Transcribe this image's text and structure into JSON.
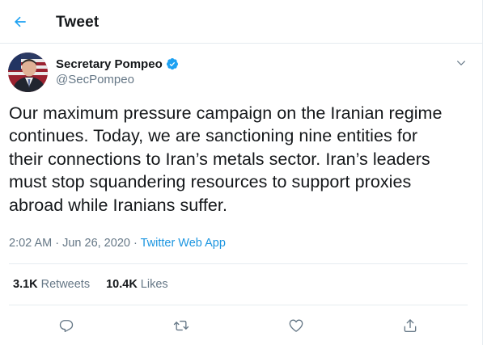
{
  "header": {
    "title": "Tweet",
    "back_icon": "arrow-left-icon",
    "accent": "#1da1f2"
  },
  "author": {
    "display_name": "Secretary Pompeo",
    "handle": "@SecPompeo",
    "verified": true,
    "verified_icon": "verified-badge-icon",
    "more_icon": "chevron-down-icon"
  },
  "tweet": {
    "text_lines": [
      "Our maximum pressure campaign on the Iranian regime",
      "continues. Today, we are sanctioning nine entities for",
      "their connections to Iran’s metals sector. Iran’s leaders",
      "must stop squandering resources to support proxies",
      "abroad while Iranians suffer."
    ],
    "time": "2:02 AM",
    "separator1": " · ",
    "date": "Jun 26, 2020",
    "separator2": " · ",
    "source": "Twitter Web App"
  },
  "stats": {
    "retweets_count": "3.1K",
    "retweets_label": "Retweets",
    "likes_count": "10.4K",
    "likes_label": "Likes"
  },
  "actions": [
    {
      "icon": "reply-icon"
    },
    {
      "icon": "retweet-icon"
    },
    {
      "icon": "heart-icon"
    },
    {
      "icon": "share-icon"
    }
  ],
  "colors": {
    "text": "#14171a",
    "secondary": "#657786",
    "link": "#1b95e0",
    "border": "#e6ecf0"
  }
}
